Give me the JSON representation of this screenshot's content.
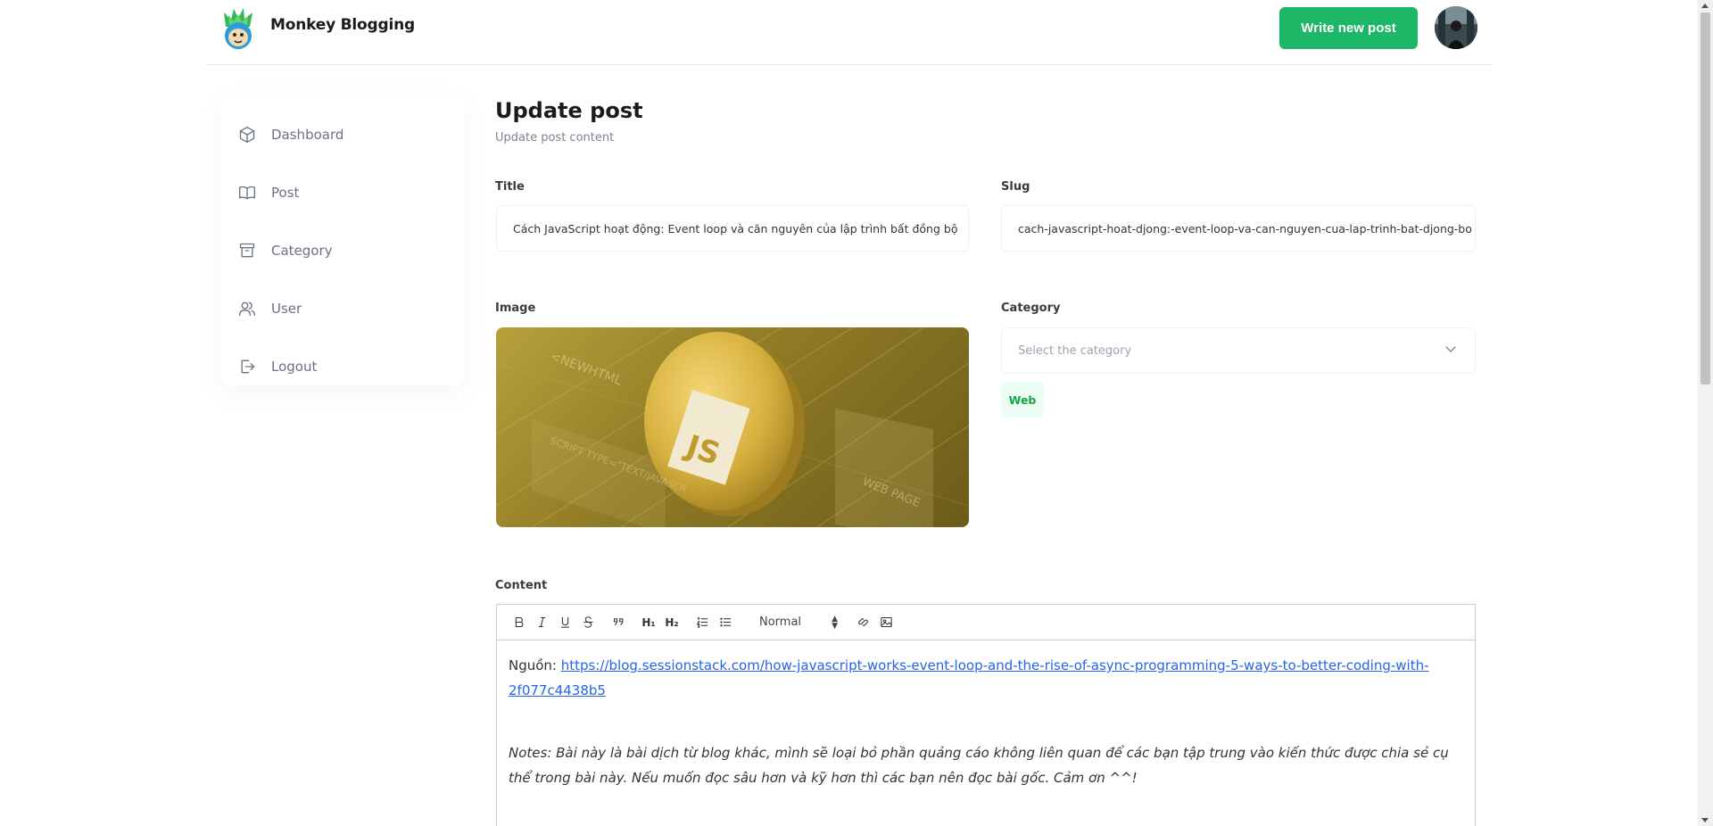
{
  "header": {
    "brand": "Monkey Blogging",
    "write_button": "Write new post"
  },
  "sidebar": {
    "items": [
      {
        "label": "Dashboard",
        "icon": "cube-icon"
      },
      {
        "label": "Post",
        "icon": "book-icon"
      },
      {
        "label": "Category",
        "icon": "archive-icon"
      },
      {
        "label": "User",
        "icon": "users-icon"
      },
      {
        "label": "Logout",
        "icon": "logout-icon"
      }
    ]
  },
  "main": {
    "title": "Update post",
    "subtitle": "Update post content",
    "fields": {
      "title_label": "Title",
      "title_value": "Cách JavaScript hoạt động: Event loop và căn nguyên của lập trình bất đồng bộ",
      "slug_label": "Slug",
      "slug_value": "cach-javascript-hoat-djong:-event-loop-va-can-nguyen-cua-lap-trinh-bat-djong-bo",
      "image_label": "Image",
      "category_label": "Category",
      "category_placeholder": "Select the category",
      "category_selected": "Web",
      "content_label": "Content"
    },
    "editor": {
      "heading_select": "Normal",
      "source_prefix": "Nguồn: ",
      "source_url": "https://blog.sessionstack.com/how-javascript-works-event-loop-and-the-rise-of-async-programming-5-ways-to-better-coding-with-2f077c4438b5",
      "notes": "Notes: Bài này là bài dịch từ blog khác, mình sẽ loại bỏ phần quảng cáo không liên quan để các bạn tập trung vào kiến thức được chia sẻ cụ thể trong bài này. Nếu muốn đọc sâu hơn và kỹ hơn thì các bạn nên đọc bài gốc. Cảm ơn ^^!"
    },
    "image_text": {
      "badge": "JS",
      "top_left": "<NEWHTML",
      "lower": "SCRIPT TYPE=\"TEXT/JAVASCR",
      "right": "WEB PAGE"
    }
  },
  "colors": {
    "accent": "#1db768",
    "tag_bg": "#ecfdf3",
    "link": "#2563eb"
  }
}
